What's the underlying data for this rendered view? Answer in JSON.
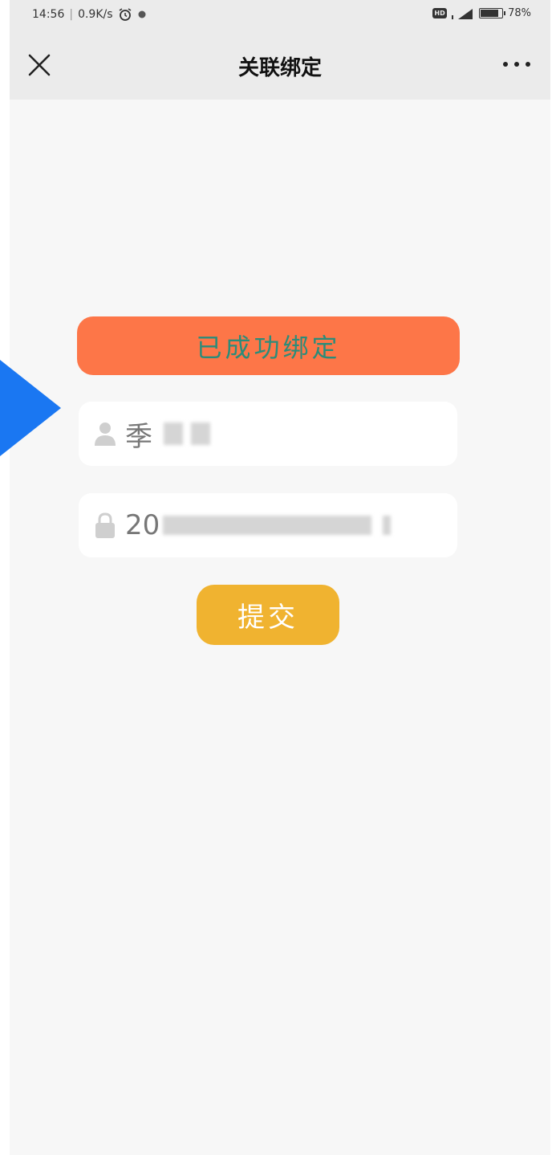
{
  "status_bar": {
    "time": "14:56",
    "network_speed": "0.9K/s",
    "hd_badge": "HD",
    "battery": "78%"
  },
  "nav": {
    "title": "关联绑定"
  },
  "banner": {
    "text": "已成功绑定"
  },
  "form": {
    "name_value": "季",
    "password_value": "20"
  },
  "submit_label": "提交",
  "colors": {
    "banner_bg": "#fd7648",
    "banner_text": "#2a8c7a",
    "submit_bg": "#f0b330",
    "arrow": "#1a77f2"
  }
}
